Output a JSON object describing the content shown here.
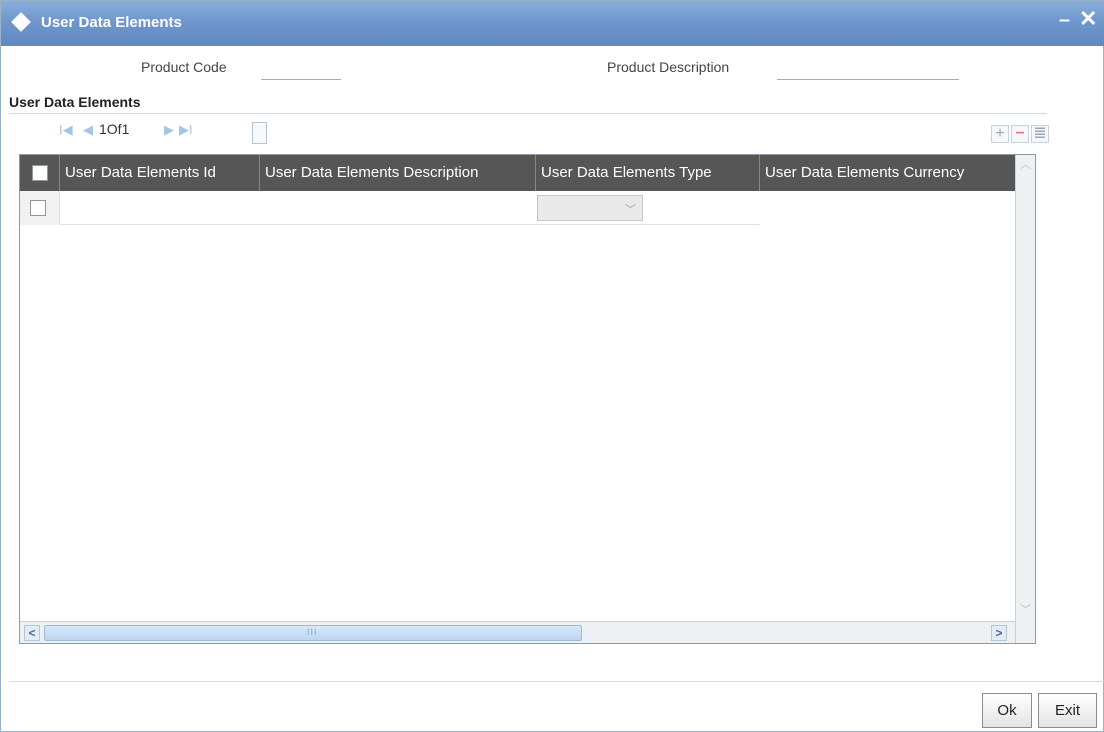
{
  "window": {
    "title": "User Data Elements",
    "minimize_glyph": "–",
    "close_glyph": "✕"
  },
  "form": {
    "product_code_label": "Product Code",
    "product_code_value": "",
    "product_description_label": "Product Description",
    "product_description_value": ""
  },
  "section": {
    "title": "User Data Elements"
  },
  "pager": {
    "first": "I◀",
    "prev": "◀",
    "text": "1Of1",
    "next": "▶",
    "last": "▶I"
  },
  "grid_tools": {
    "add": "+",
    "remove": "−",
    "view": "≣"
  },
  "grid": {
    "columns": [
      "User Data Elements Id",
      "User Data Elements Description",
      "User Data Elements Type",
      "User Data Elements Currency"
    ],
    "rows": [
      {
        "id": "",
        "description": "",
        "type": "",
        "currency": ""
      }
    ],
    "scroll_thumb_label": "III"
  },
  "buttons": {
    "ok": "Ok",
    "exit": "Exit"
  },
  "colors": {
    "titlebar": "#6f97cc",
    "grid_header": "#565656"
  }
}
